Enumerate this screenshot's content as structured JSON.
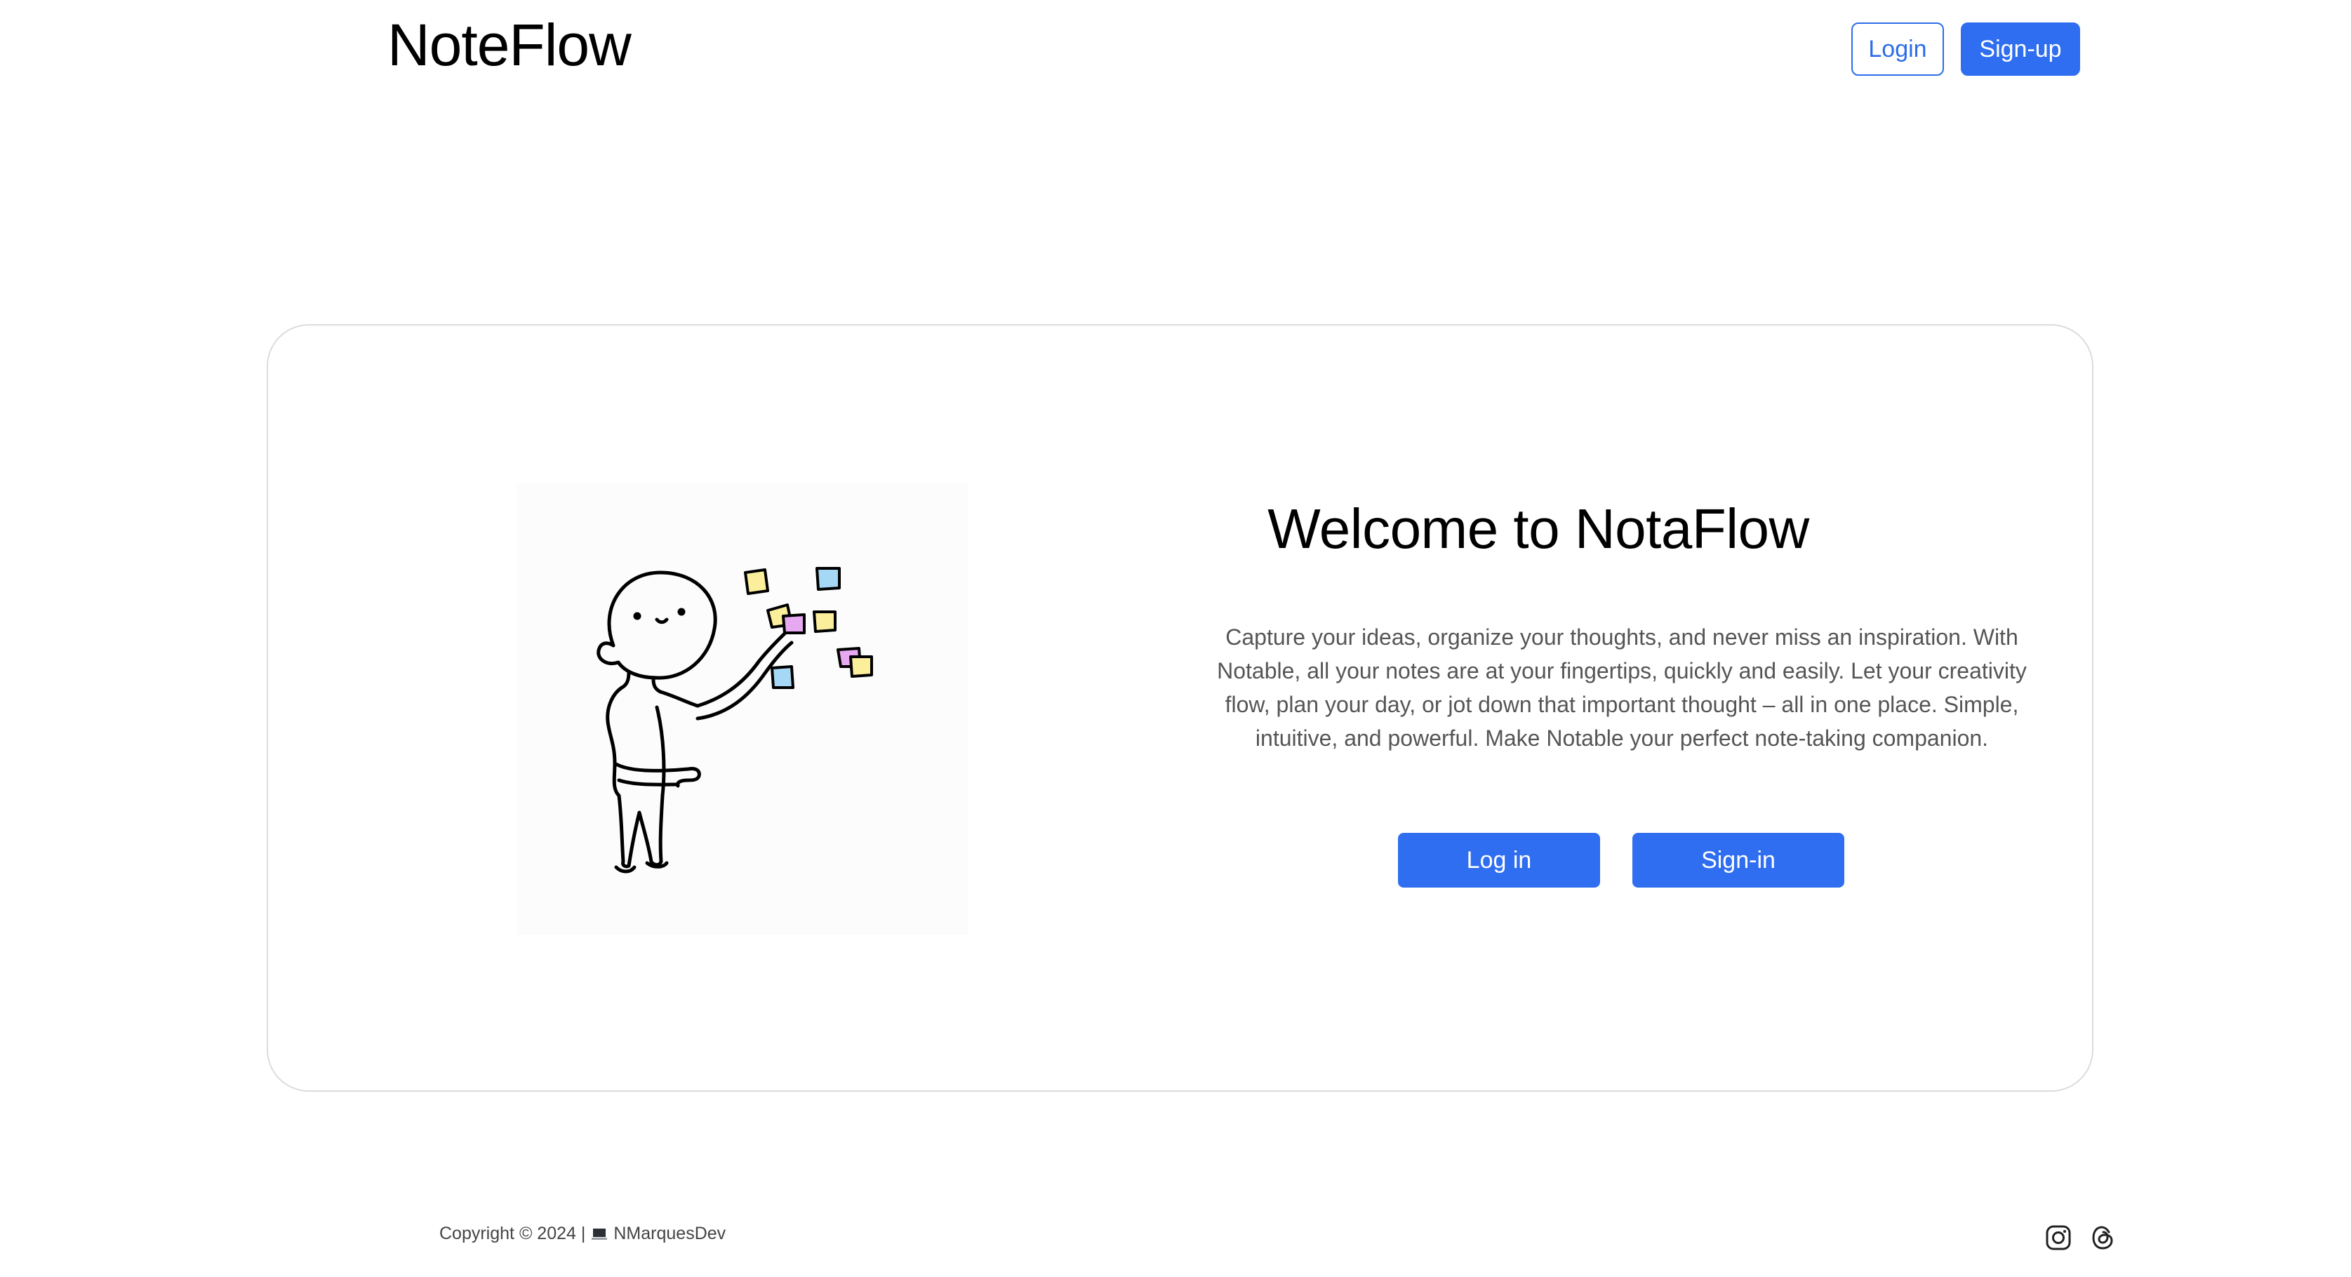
{
  "header": {
    "brand": "NoteFlow",
    "login_label": "Login",
    "signup_label": "Sign-up"
  },
  "hero": {
    "title": "Welcome to NotaFlow",
    "description": "Capture your ideas, organize your thoughts, and never miss an inspiration. With Notable, all your notes are at your fingertips, quickly and easily. Let your creativity flow, plan your day, or jot down that important thought – all in one place. Simple, intuitive, and powerful. Make Notable your perfect note-taking companion.",
    "login_button": "Log in",
    "signin_button": "Sign-in",
    "illustration_icon": "person-with-sticky-notes-illustration"
  },
  "footer": {
    "copyright": "Copyright © 2024 |",
    "author": "NMarquesDev",
    "author_icon": "laptop-icon",
    "social": [
      {
        "name": "instagram-icon"
      },
      {
        "name": "threads-icon"
      }
    ]
  },
  "colors": {
    "primary": "#2f6ef0",
    "card_border": "#dcdcdc",
    "text_muted": "#555555"
  }
}
